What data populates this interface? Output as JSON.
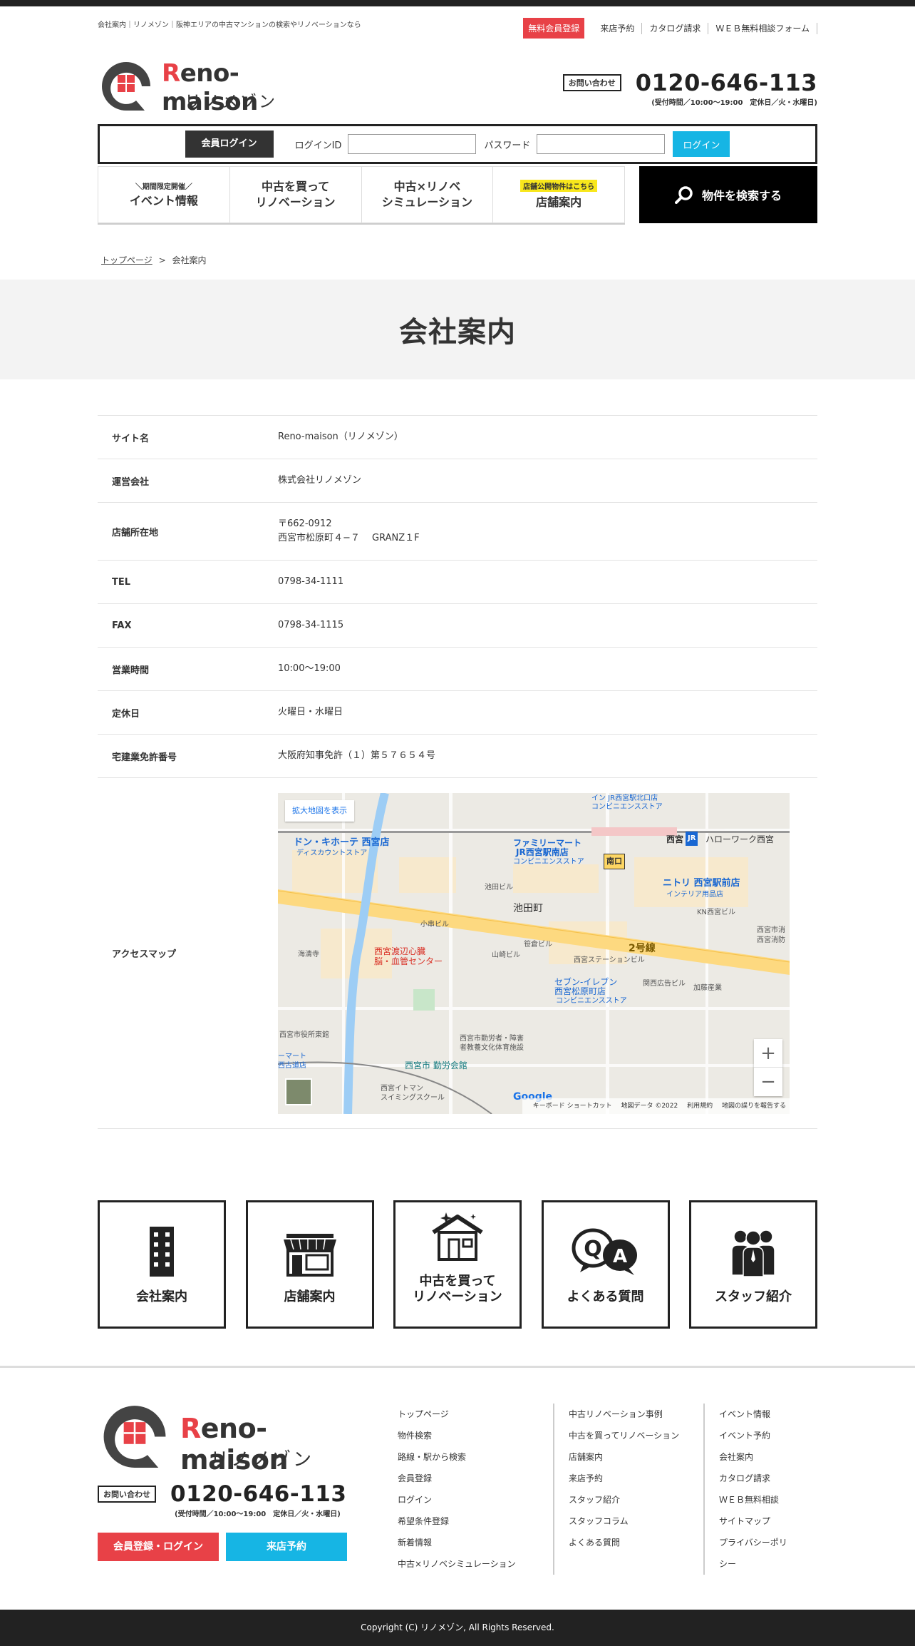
{
  "header": {
    "tagline": "会社案内｜リノメゾン｜阪神エリアの中古マンションの検索やリノベーションなら",
    "free_register": "無料会員登録",
    "links": [
      "来店予約",
      "カタログ請求",
      "ＷＥＢ無料相談フォーム"
    ],
    "logo_en_r": "R",
    "logo_en_rest": "eno-maison",
    "logo_jp": "リノメゾン",
    "contact_label": "お問い合わせ",
    "phone": "0120-646-113",
    "hours": "(受付時間／10:00〜19:00　定休日／火・水曜日)"
  },
  "login": {
    "tag": "会員ログイン",
    "id_label": "ログインID",
    "password_label": "パスワード",
    "button": "ログイン"
  },
  "nav": {
    "items": [
      {
        "small": "＼期間限定開催／",
        "big": "イベント情報"
      },
      {
        "big1": "中古を買って",
        "big2": "リノベーション"
      },
      {
        "big1": "中古×リノベ",
        "big2": "シミュレーション"
      },
      {
        "badge": "店舗公開物件はこちら",
        "big": "店舗案内"
      }
    ],
    "search": "物件を検索する"
  },
  "breadcrumb": {
    "home": "トップページ",
    "sep": ">",
    "current": "会社案内"
  },
  "page_title": "会社案内",
  "company": {
    "rows": [
      {
        "label": "サイト名",
        "value": "Reno-maison（リノメゾン）"
      },
      {
        "label": "運営会社",
        "value": "株式会社リノメゾン"
      },
      {
        "label": "店舗所在地",
        "value": "〒662-0912",
        "value2": "西宮市松原町４−７　 GRANZ１F"
      },
      {
        "label": "TEL",
        "value": "0798-34-1111"
      },
      {
        "label": "FAX",
        "value": "0798-34-1115"
      },
      {
        "label": "営業時間",
        "value": "10:00～19:00"
      },
      {
        "label": "定休日",
        "value": "火曜日・水曜日"
      },
      {
        "label": "宅建業免許番号",
        "value": "大阪府知事免許（１）第５７６５４号"
      }
    ],
    "map_label": "アクセスマップ"
  },
  "map": {
    "enlarge": "拡大地図を表示",
    "zoom_in": "+",
    "zoom_out": "−",
    "google": "Google",
    "footer": [
      "キーボード ショートカット",
      "地図データ ©2022",
      "利用規約",
      "地図の誤りを報告する"
    ],
    "labels": {
      "donki": "ドン・キホーテ 西宮店",
      "donki_sub": "ディスカウントストア",
      "famima": "ファミリーマート",
      "famima2": "JR西宮駅南店",
      "famima_sub": "コンビニエンスストア",
      "top": "イン JR西宮駅北口店",
      "top_sub": "コンビニエンスストア",
      "nishinomiya": "西宮",
      "jr": "JR",
      "hellowork": "ハローワーク西宮",
      "minamiguchi": "南口",
      "nitori": "ニトリ 西宮駅前店",
      "nitori_sub": "インテリア用品店",
      "ikeda_bldg": "池田ビル",
      "ikedacho": "池田町",
      "kn": "KN西宮ビル",
      "kokushi": "小串ビル",
      "route2": "2号線",
      "sasagi": "笹倉ビル",
      "yamasaki": "山崎ビル",
      "station_bldg": "西宮ステーションビル",
      "kansai": "関西広告ビル",
      "kato": "加藤産業",
      "hospital": "西宮渡辺心臓",
      "hospital2": "脳・血管センター",
      "kaiseiji": "海清寺",
      "seven": "セブン-イレブン",
      "seven2": "西宮松原町店",
      "seven_sub": "コンビニエンスストア",
      "city_hall": "西宮市役所東館",
      "labor": "西宮市 勤労会館",
      "labor_center": "西宮市勤労者・障害",
      "labor_center2": "者教養文化体育施設",
      "mart": "ーマート",
      "mart2": "西古道店",
      "swim": "西宮イトマン",
      "swim2": "スイミングスクール",
      "nishinomiya_r": "西宮市消",
      "nishinomiya_r2": "西宮消防"
    }
  },
  "features": [
    {
      "label": "会社案内",
      "icon": "building-icon"
    },
    {
      "label": "店舗案内",
      "icon": "store-icon"
    },
    {
      "label": "中古を買って",
      "label2": "リノベーション",
      "icon": "house-sparkle-icon"
    },
    {
      "label": "よくある質問",
      "icon": "qa-icon"
    },
    {
      "label": "スタッフ紹介",
      "icon": "staff-icon"
    }
  ],
  "footer": {
    "logo_en_r": "R",
    "logo_en_rest": "eno-maison",
    "logo_jp": "リノメゾン",
    "contact_label": "お問い合わせ",
    "phone": "0120-646-113",
    "hours": "(受付時間／10:00〜19:00　定休日／火・水曜日)",
    "btn_register": "会員登録・ログイン",
    "btn_visit": "来店予約",
    "col1": [
      "トップページ",
      "物件検索",
      "路線・駅から検索",
      "会員登録",
      "ログイン",
      "希望条件登録",
      "新着情報",
      "中古×リノベシミュレーション"
    ],
    "col2": [
      "中古リノベーション事例",
      "中古を買ってリノベーション",
      "店舗案内",
      "来店予約",
      "スタッフ紹介",
      "スタッフコラム",
      "よくある質問"
    ],
    "col3": [
      "イベント情報",
      "イベント予約",
      "会社案内",
      "カタログ請求",
      "ＷＥＢ無料相談",
      "サイトマップ",
      "プライバシーポリシー"
    ],
    "copyright": "Copyright (C) リノメゾン, All Rights Reserved."
  }
}
